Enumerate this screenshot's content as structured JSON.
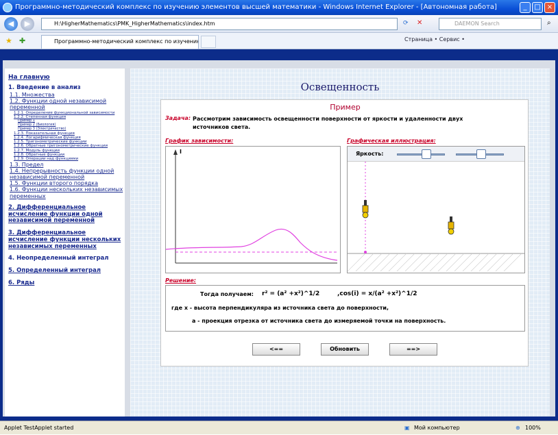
{
  "window": {
    "title": "Программно-методический комплекс по изучению элементов высшей математики - Windows Internet Explorer - [Автономная работа]"
  },
  "browser": {
    "address": "H:\\HigherMathematics\\PMK_HigherMathematics\\index.htm",
    "search_placeholder": "DAEMON Search",
    "tab_title": "Программно-методический комплекс по изучению ...",
    "tools": "Страница • Сервис •"
  },
  "sidebar": {
    "home": "На главную",
    "s1": "1. Введение в анализ",
    "s1_1": "1.1. Множества",
    "s1_2": "1.2. Функции одной независимой переменной",
    "s1_2_1": "1.2.1. Определение функциональной зависимости",
    "s1_2_2": "1.2.2. Степенная функция",
    "ex1": "Пример 1",
    "ex2": "Пример 2 (Биология)",
    "ex3": "Пример 3 (Электричество)",
    "s1_2_3": "1.2.3. Показательная функция",
    "s1_2_4": "1.2.4. Логарифмическая функция",
    "s1_2_5": "1.2.5. Тригонометрические функции",
    "s1_2_6": "1.2.6. Обратные тригонометрические функции",
    "s1_2_7": "1.2.7. Модуль функции",
    "s1_2_8": "1.2.8. Обратные функции",
    "s1_2_9": "1.2.9. Операции над функциями",
    "s1_3": "1.3. Предел",
    "s1_4": "1.4. Непрерывность функции одной независимой переменной",
    "s1_5": "1.5. Функции второго порядка",
    "s1_6": "1.6. Функции нескольких независимых переменных",
    "s2": "2. Дифференциальное исчисление функции одной независимой переменной",
    "s3": "3. Дифференциальное исчисление функции нескольких независимых переменных",
    "s4": "4. Неопределенный интеграл",
    "s5": "5. Определенный интеграл",
    "s6": "6. Ряды"
  },
  "main": {
    "title": "Освещенность",
    "example": "Пример",
    "task_label": "Задача:",
    "task_text": "Рассмотрим зависимость освещенности поверхности от яркости и удаленности двух источников света.",
    "graph_label": "График зависимости:",
    "illus_label": "Графическая иллюстрация:",
    "brightness_label": "Яркость:",
    "axis_I": "I",
    "solution_label": "Решение:",
    "sol_line1": "Тогда получаем:",
    "sol_formula1": "r² = (a² +x²)^1/2",
    "sol_formula2": ",cos(i) = x/(a² +x²)^1/2",
    "sol_line2": "где   x - высота перпендикуляра из источника света до поверхности,",
    "sol_line3": "а - проекция отрезка от источника света до измеряемой точки на поверхность.",
    "btn_prev": "<==",
    "btn_refresh": "Обновить",
    "btn_next": "==>"
  },
  "status": {
    "left": "Applet TestApplet started",
    "zone": "Мой компьютер",
    "zoom": "100%"
  },
  "colors": {
    "title_bg": "#0a4fd6",
    "nav_link": "#1a2b8f",
    "accent_red": "#c80028",
    "curve": "#e040e0"
  }
}
